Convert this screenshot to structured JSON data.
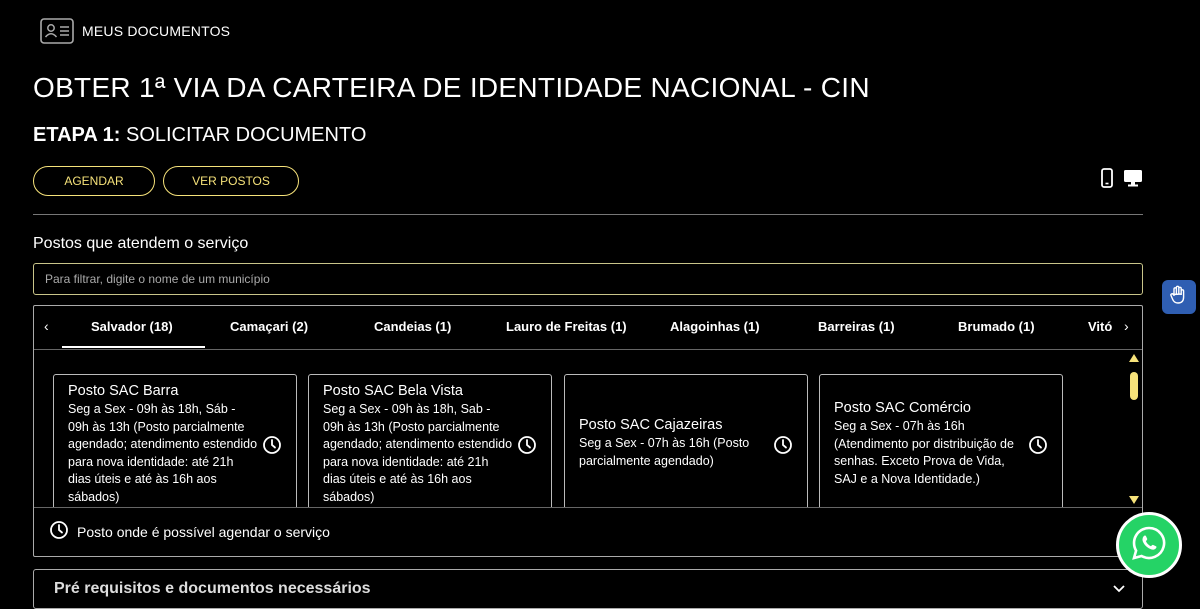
{
  "header": {
    "brand_label": "MEUS DOCUMENTOS",
    "brand_icon": "id-card-icon"
  },
  "page": {
    "title": "OBTER 1ª VIA DA CARTEIRA DE IDENTIDADE NACIONAL - CIN",
    "step_prefix": "ETAPA 1:",
    "step_title": "SOLICITAR DOCUMENTO"
  },
  "actions": {
    "schedule_label": "AGENDAR",
    "view_posts_label": "VER POSTOS"
  },
  "view_toggle": {
    "mobile_icon": "mobile-icon",
    "desktop_icon": "desktop-icon"
  },
  "posts_section": {
    "label": "Postos que atendem o serviço",
    "filter_placeholder": "Para filtrar, digite o nome de um município",
    "tabs": [
      {
        "label": "Salvador (18)",
        "selected": true
      },
      {
        "label": "Camaçari (2)"
      },
      {
        "label": "Candeias (1)"
      },
      {
        "label": "Lauro de Freitas (1)"
      },
      {
        "label": "Alagoinhas (1)"
      },
      {
        "label": "Barreiras (1)"
      },
      {
        "label": "Brumado (1)"
      },
      {
        "label": "Vitó"
      }
    ],
    "cards": [
      {
        "name": "Posto SAC Barra",
        "hours": "Seg a Sex - 09h às 18h, Sáb - 09h às 13h (Posto parcialmente agendado; atendimento estendido para nova identidade: até 21h dias úteis e até às 16h aos sábados)"
      },
      {
        "name": "Posto SAC Bela Vista",
        "hours": "Seg a Sex - 09h às 18h, Sab - 09h às 13h (Posto parcialmente agendado; atendimento estendido para nova identidade: até 21h dias úteis e até às 16h aos sábados)"
      },
      {
        "name": "Posto SAC Cajazeiras",
        "hours": "Seg a Sex - 07h às 16h (Posto parcialmente agendado)"
      },
      {
        "name": "Posto SAC Comércio",
        "hours": "Seg a Sex - 07h às 16h (Atendimento por distribuição de senhas. Exceto Prova de Vida, SAJ e a Nova Identidade.)"
      }
    ],
    "legend": "Posto onde é possível agendar o serviço"
  },
  "requirements": {
    "label": "Pré requisitos e documentos necessários"
  },
  "colors": {
    "accent": "#f6e27a",
    "background": "#000000",
    "whatsapp": "#25d366",
    "accessibility": "#2f5eb2"
  }
}
